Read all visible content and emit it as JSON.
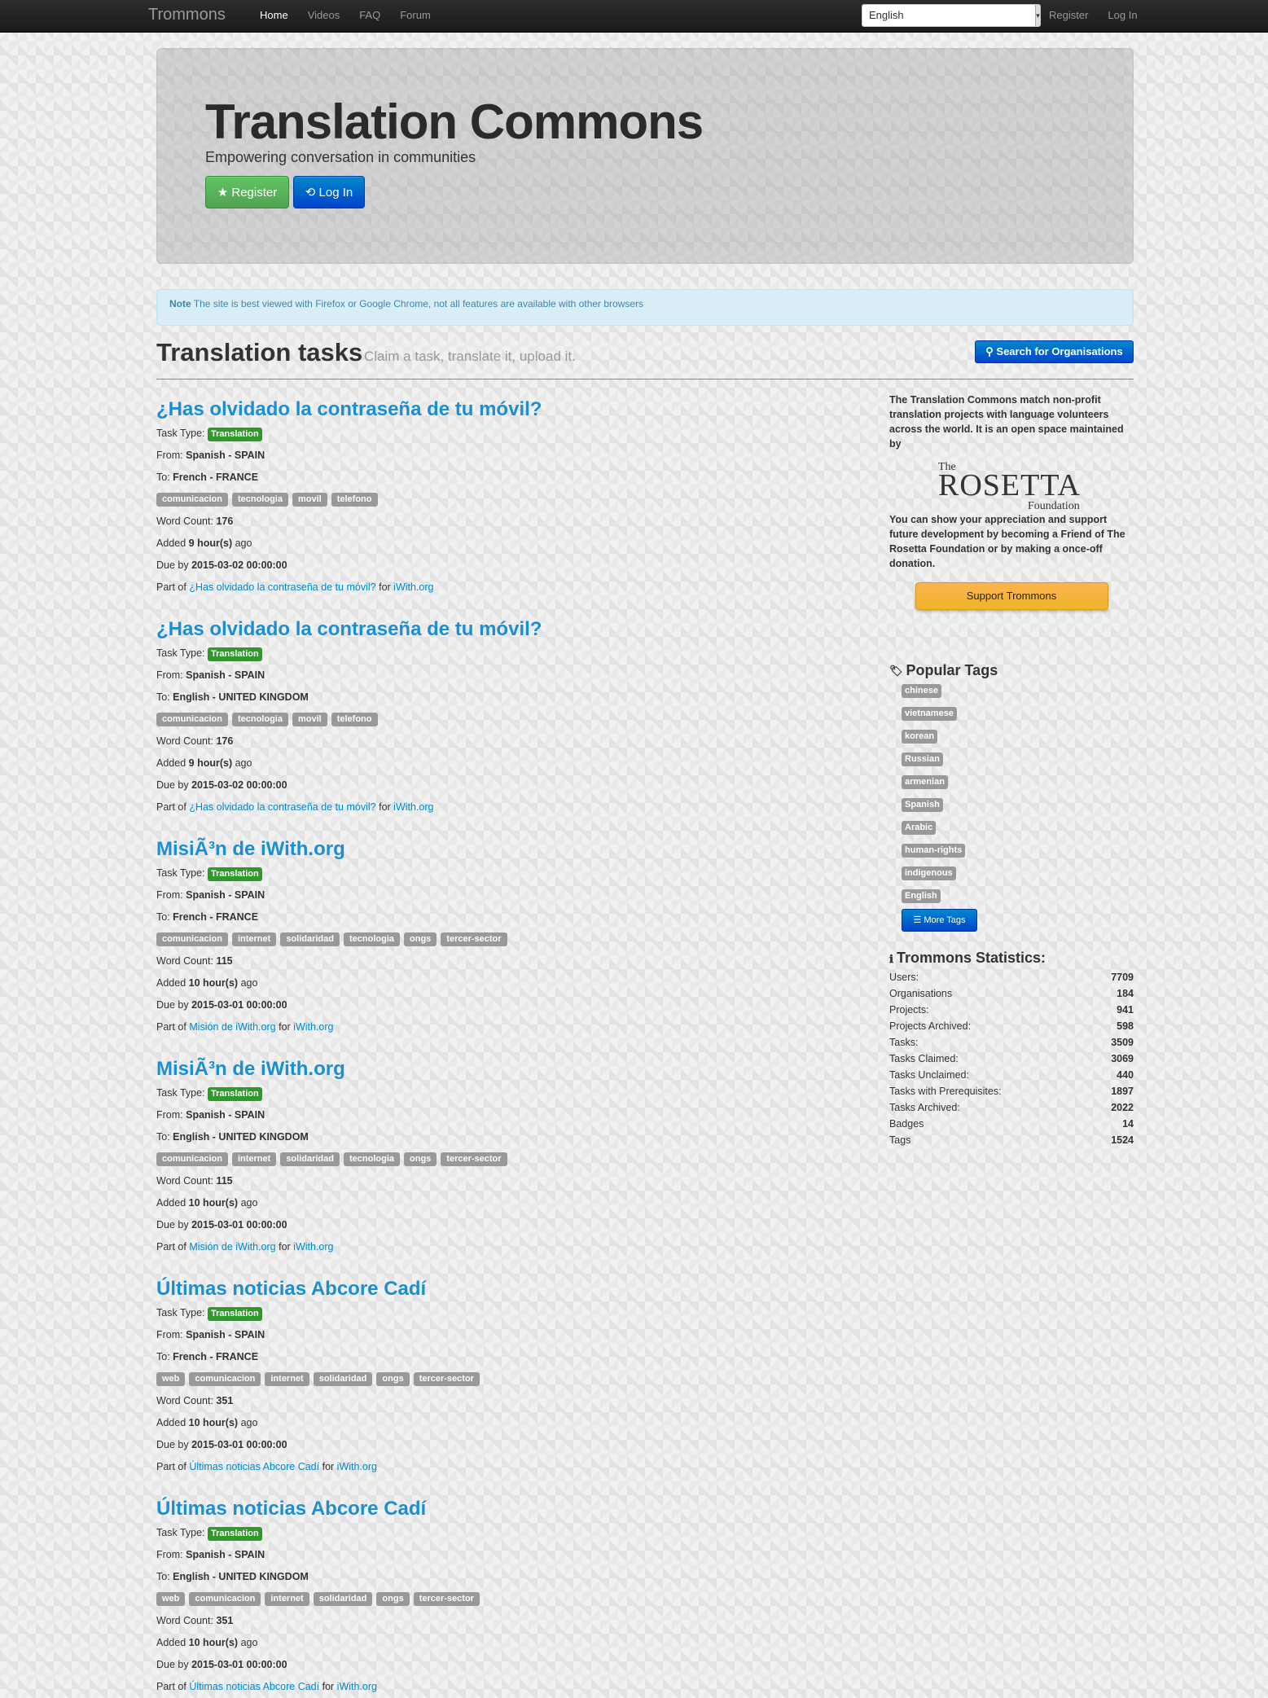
{
  "nav": {
    "brand": "Trommons",
    "items": [
      "Home",
      "Videos",
      "FAQ",
      "Forum"
    ],
    "language": "English",
    "register": "Register",
    "login": "Log In"
  },
  "hero": {
    "title": "Translation Commons",
    "subtitle": "Empowering conversation in communities",
    "register_btn": "Register",
    "login_btn": "Log In"
  },
  "alert": {
    "label": "Note",
    "text": "The site is best viewed with Firefox or Google Chrome, not all features are available with other browsers"
  },
  "section": {
    "title": "Translation tasks",
    "subtitle": "Claim a task, translate it, upload it.",
    "search_btn": "Search for Organisations"
  },
  "labels": {
    "task_type": "Task Type:",
    "from": "From:",
    "to": "To:",
    "word_count": "Word Count:",
    "added": "Added",
    "ago": "ago",
    "due": "Due by",
    "part_of": "Part of",
    "for": "for"
  },
  "tasks": [
    {
      "title": "¿Has olvidado la contraseña de tu móvil?",
      "type": "Translation",
      "from": "Spanish - SPAIN",
      "to": "French - FRANCE",
      "tags": [
        "comunicacion",
        "tecnologia",
        "movil",
        "telefono"
      ],
      "words": "176",
      "added": "9 hour(s)",
      "due": "2015-03-02 00:00:00",
      "project": "¿Has olvidado la contraseña de tu móvil?",
      "org": "iWith.org"
    },
    {
      "title": "¿Has olvidado la contraseña de tu móvil?",
      "type": "Translation",
      "from": "Spanish - SPAIN",
      "to": "English - UNITED KINGDOM",
      "tags": [
        "comunicacion",
        "tecnologia",
        "movil",
        "telefono"
      ],
      "words": "176",
      "added": "9 hour(s)",
      "due": "2015-03-02 00:00:00",
      "project": "¿Has olvidado la contraseña de tu móvil?",
      "org": "iWith.org"
    },
    {
      "title": "MisiÃ³n de iWith.org",
      "type": "Translation",
      "from": "Spanish - SPAIN",
      "to": "French - FRANCE",
      "tags": [
        "comunicacion",
        "internet",
        "solidaridad",
        "tecnologia",
        "ongs",
        "tercer-sector"
      ],
      "words": "115",
      "added": "10 hour(s)",
      "due": "2015-03-01 00:00:00",
      "project": "Misión de iWith.org",
      "org": "iWith.org"
    },
    {
      "title": "MisiÃ³n de iWith.org",
      "type": "Translation",
      "from": "Spanish - SPAIN",
      "to": "English - UNITED KINGDOM",
      "tags": [
        "comunicacion",
        "internet",
        "solidaridad",
        "tecnologia",
        "ongs",
        "tercer-sector"
      ],
      "words": "115",
      "added": "10 hour(s)",
      "due": "2015-03-01 00:00:00",
      "project": "Misión de iWith.org",
      "org": "iWith.org"
    },
    {
      "title": "Últimas noticias Abcore Cadí",
      "type": "Translation",
      "from": "Spanish - SPAIN",
      "to": "French - FRANCE",
      "tags": [
        "web",
        "comunicacion",
        "internet",
        "solidaridad",
        "ongs",
        "tercer-sector"
      ],
      "words": "351",
      "added": "10 hour(s)",
      "due": "2015-03-01 00:00:00",
      "project": "Últimas noticias Abcore Cadí",
      "org": "iWith.org"
    },
    {
      "title": "Últimas noticias Abcore Cadí",
      "type": "Translation",
      "from": "Spanish - SPAIN",
      "to": "English - UNITED KINGDOM",
      "tags": [
        "web",
        "comunicacion",
        "internet",
        "solidaridad",
        "ongs",
        "tercer-sector"
      ],
      "words": "351",
      "added": "10 hour(s)",
      "due": "2015-03-01 00:00:00",
      "project": "Últimas noticias Abcore Cadí",
      "org": "iWith.org"
    }
  ],
  "sidebar": {
    "intro": "The Translation Commons match non-profit translation projects with language volunteers across the world. It is an open space maintained by",
    "logo": {
      "the": "The",
      "name": "ROSETTA",
      "foundation": "Foundation"
    },
    "support_text": "You can show your appreciation and support future development by becoming a Friend of The Rosetta Foundation or by making a once-off donation.",
    "support_btn": "Support Trommons",
    "popular_title": "Popular Tags",
    "popular_tags": [
      "chinese",
      "vietnamese",
      "korean",
      "Russian",
      "armenian",
      "Spanish",
      "Arabic",
      "human-rights",
      "indigenous",
      "English"
    ],
    "more_tags": "More Tags",
    "stats_title": "Trommons Statistics:",
    "stats": [
      {
        "label": "Users:",
        "value": "7709"
      },
      {
        "label": "Organisations",
        "value": "184"
      },
      {
        "label": "Projects:",
        "value": "941"
      },
      {
        "label": "Projects Archived:",
        "value": "598"
      },
      {
        "label": "Tasks:",
        "value": "3509"
      },
      {
        "label": "Tasks Claimed:",
        "value": "3069"
      },
      {
        "label": "Tasks Unclaimed:",
        "value": "440"
      },
      {
        "label": "Tasks with Prerequisites:",
        "value": "1897"
      },
      {
        "label": "Tasks Archived:",
        "value": "2022"
      },
      {
        "label": "Badges",
        "value": "14"
      },
      {
        "label": "Tags",
        "value": "1524"
      }
    ]
  }
}
